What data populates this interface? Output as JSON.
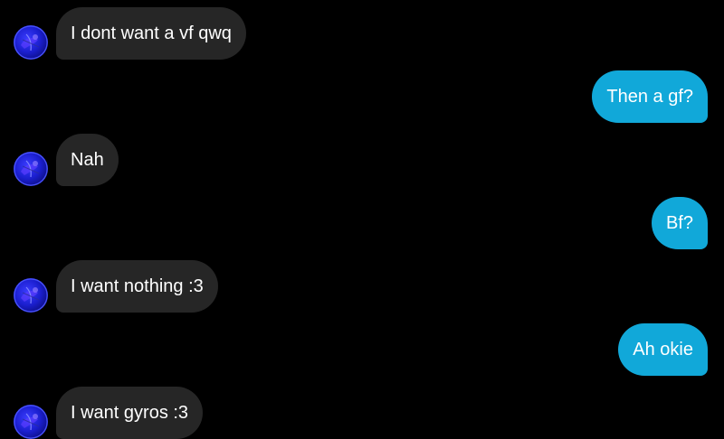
{
  "messages": [
    {
      "direction": "in",
      "text": "I dont want a vf qwq"
    },
    {
      "direction": "out",
      "text": "Then a gf?"
    },
    {
      "direction": "in",
      "text": "Nah"
    },
    {
      "direction": "out",
      "text": "Bf?"
    },
    {
      "direction": "in",
      "text": "I want nothing :3"
    },
    {
      "direction": "out",
      "text": "Ah okie"
    },
    {
      "direction": "in",
      "text": "I want gyros :3"
    }
  ],
  "colors": {
    "background": "#000000",
    "incoming_bubble": "#262626",
    "outgoing_bubble": "#11a8d9",
    "text": "#ffffff",
    "avatar_accent": "#1b1fcf"
  },
  "icons": {
    "avatar": "contact-avatar"
  }
}
